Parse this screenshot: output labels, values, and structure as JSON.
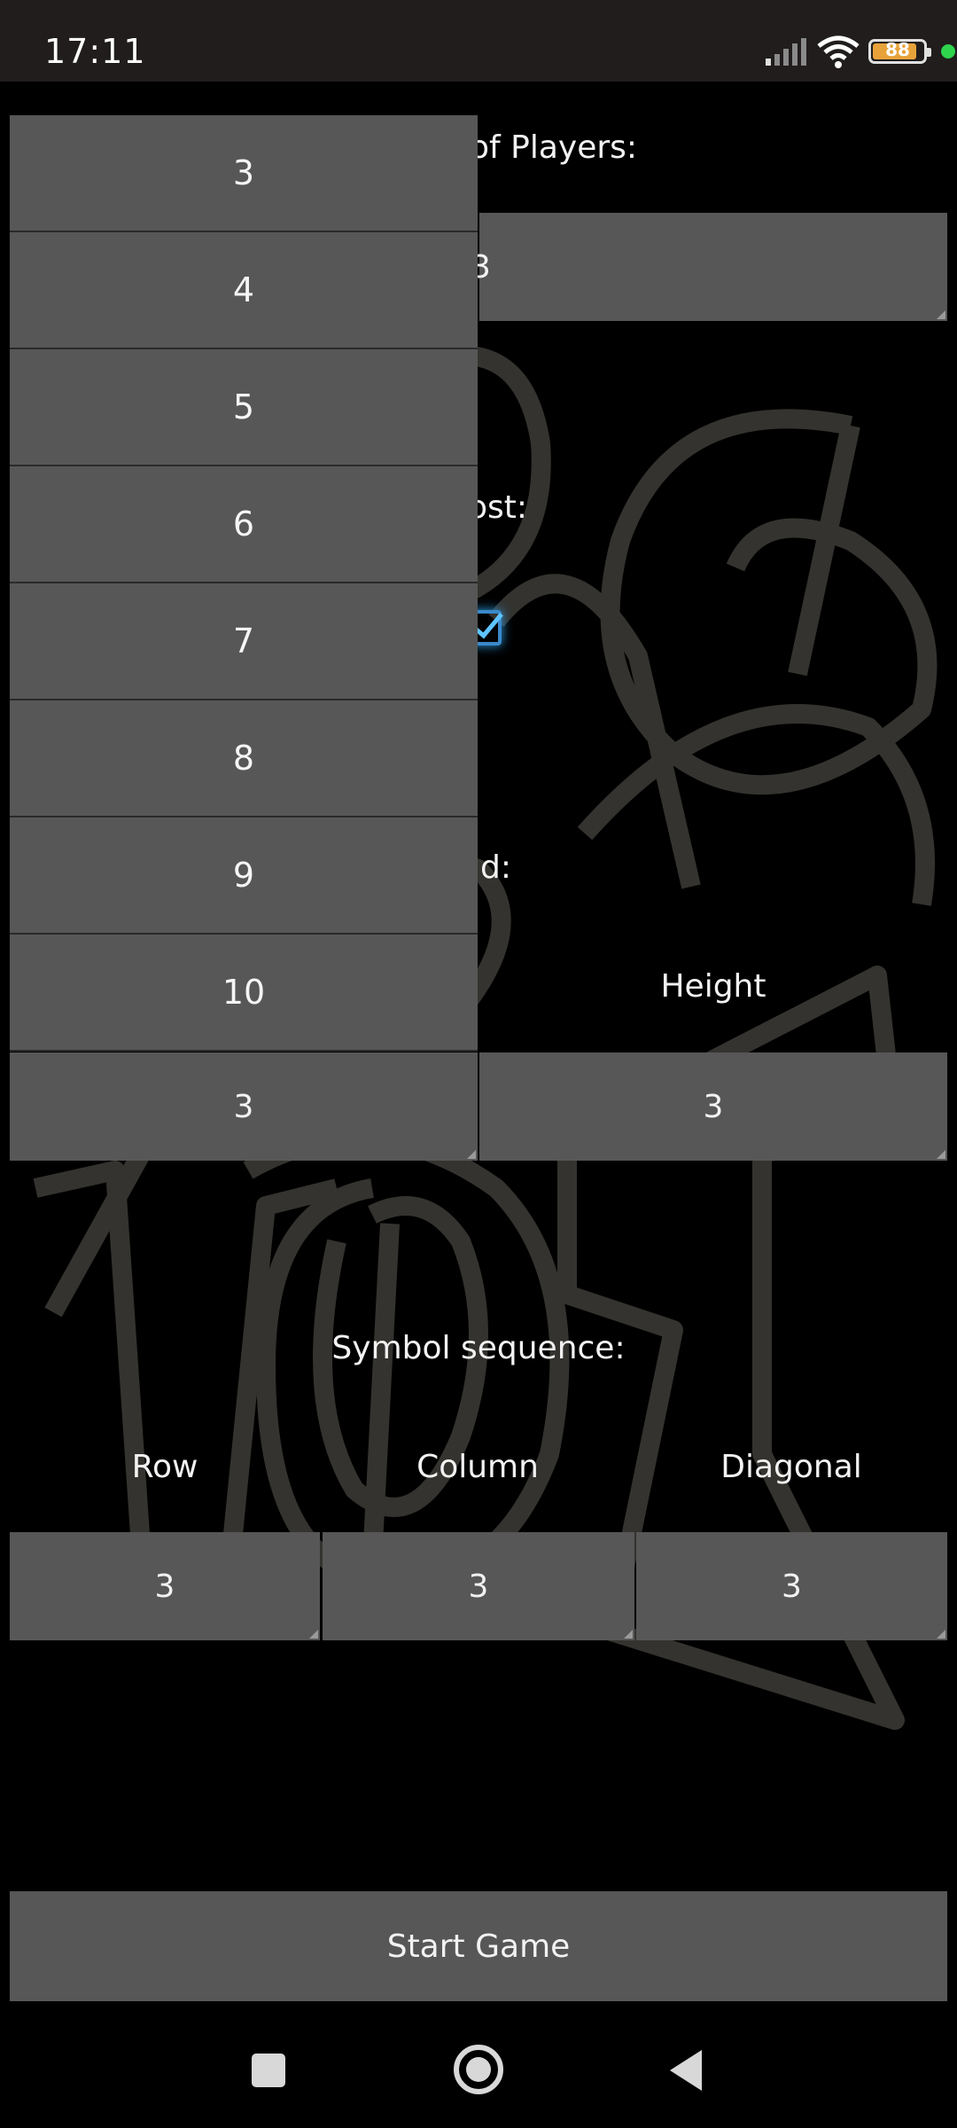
{
  "status_bar": {
    "time": "17:11",
    "battery": "88",
    "battery_level": 0.88
  },
  "players": {
    "label": "Number of Players:",
    "label_visible": "of Players:",
    "value": "3"
  },
  "host": {
    "label_visible": "ost:",
    "checked": true
  },
  "grid": {
    "label_visible": "id:",
    "height_label": "Height",
    "width_value": "3",
    "height_value": "3"
  },
  "dropdown": {
    "options": [
      "3",
      "4",
      "5",
      "6",
      "7",
      "8",
      "9",
      "10"
    ]
  },
  "symbol_sequence": {
    "label": "Symbol sequence:",
    "row_label": "Row",
    "column_label": "Column",
    "diagonal_label": "Diagonal",
    "row_value": "3",
    "column_value": "3",
    "diagonal_value": "3"
  },
  "start_button": {
    "label": "Start Game"
  },
  "colors": {
    "field": "#575757",
    "status_bar": "#211d1d",
    "background": "#000000",
    "checkbox_accent": "#3a89c9"
  }
}
